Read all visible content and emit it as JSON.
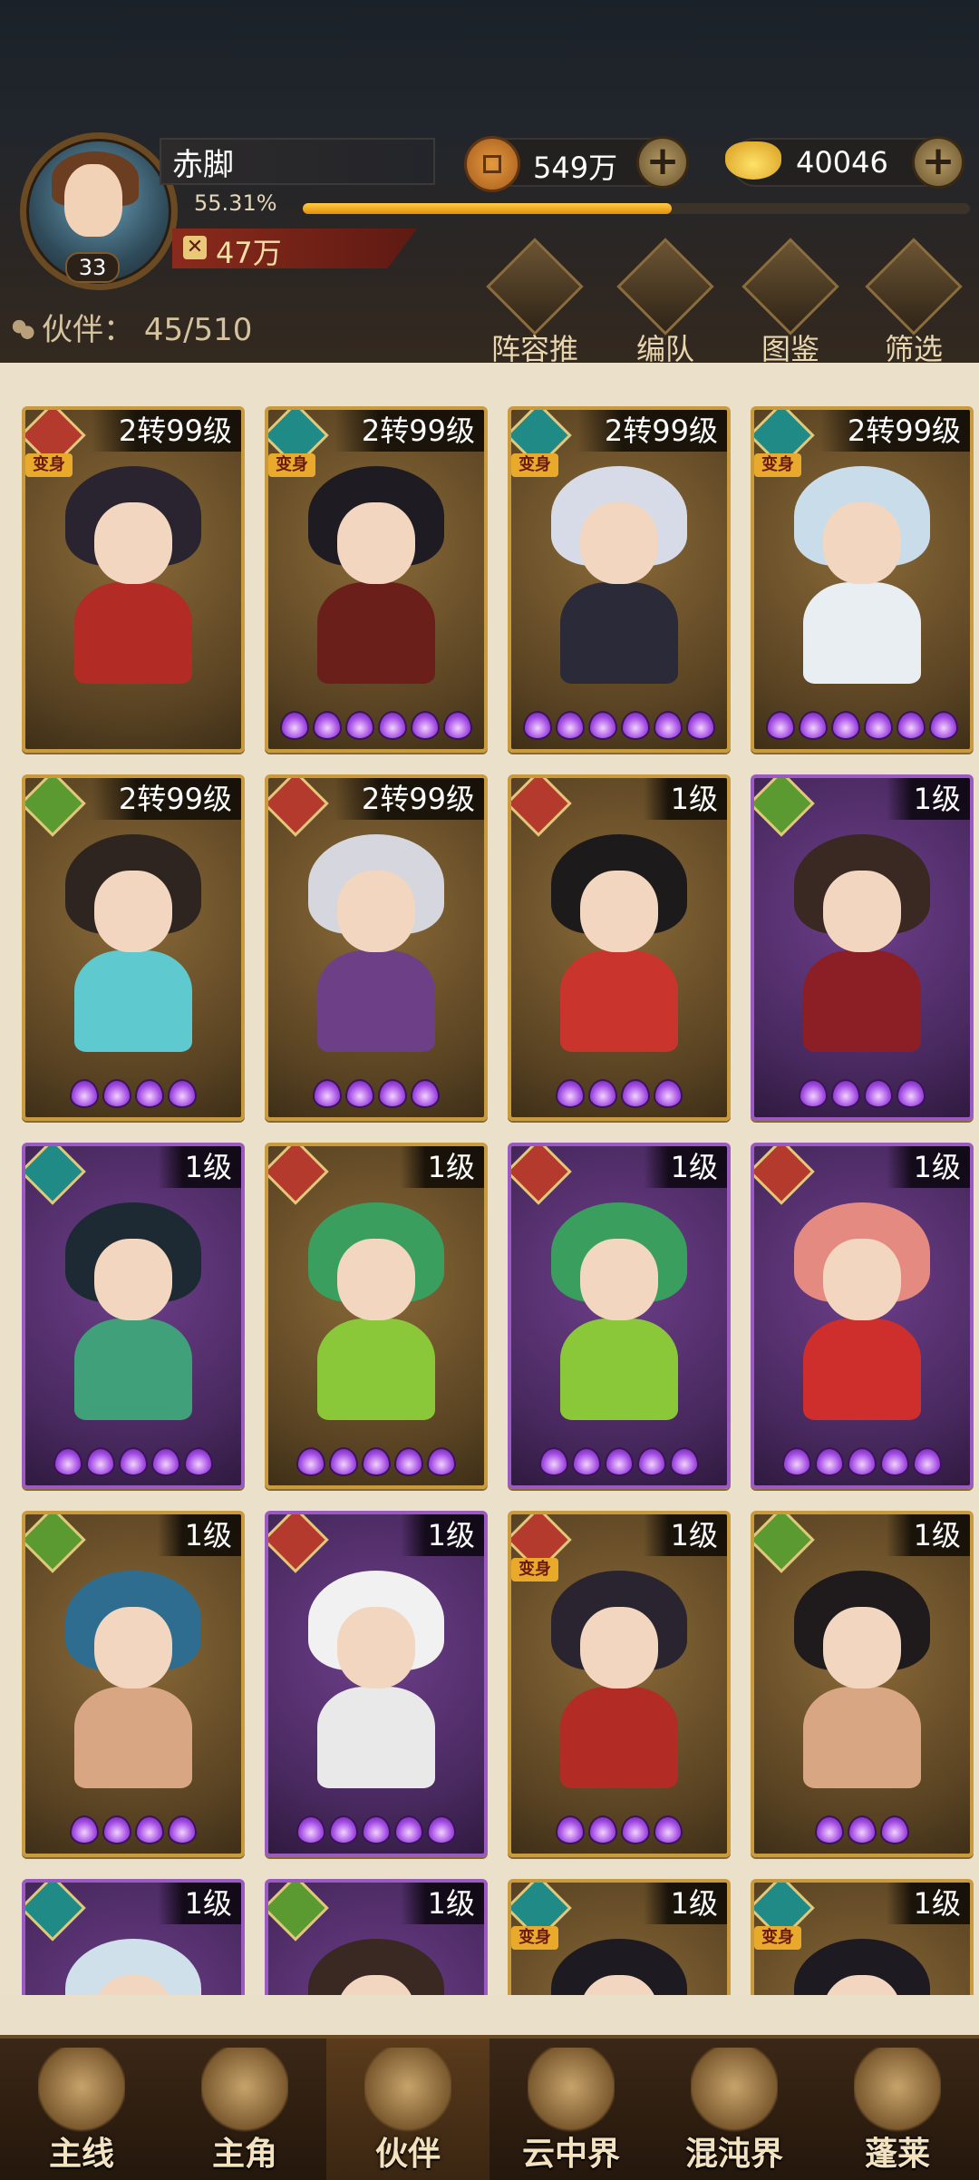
{
  "header": {
    "player_name": "赤脚",
    "player_level": "33",
    "exp_percent_label": "55.31%",
    "exp_fraction": 0.5531,
    "combat_power": "47万",
    "coins": "549万",
    "ingots": "40046",
    "partners_label": "伙伴：",
    "partners_count": "45/510",
    "tools": [
      {
        "label": "阵容推荐",
        "icon": "lineup-recommend-icon"
      },
      {
        "label": "编队",
        "icon": "flag-icon"
      },
      {
        "label": "图鉴",
        "icon": "scroll-icon"
      },
      {
        "label": "筛选",
        "icon": "filter-icon"
      }
    ]
  },
  "cards": [
    {
      "level": "2转99级",
      "element": "fire",
      "transform": true,
      "stars": 0,
      "frame": "gold",
      "hair": "#2a2430",
      "body": "#b22b24"
    },
    {
      "level": "2转99级",
      "element": "water",
      "transform": true,
      "stars": 6,
      "frame": "gold",
      "hair": "#1f1b22",
      "body": "#6a1f1a"
    },
    {
      "level": "2转99级",
      "element": "water",
      "transform": true,
      "stars": 6,
      "frame": "gold",
      "hair": "#d7dbe8",
      "body": "#2b2a38"
    },
    {
      "level": "2转99级",
      "element": "water",
      "transform": true,
      "stars": 6,
      "frame": "gold",
      "hair": "#c9dcea",
      "body": "#e9eef2"
    },
    {
      "level": "2转99级",
      "element": "wind",
      "transform": false,
      "stars": 4,
      "frame": "gold",
      "hair": "#2e2420",
      "body": "#5ecad0"
    },
    {
      "level": "2转99级",
      "element": "fire",
      "transform": false,
      "stars": 4,
      "frame": "gold",
      "hair": "#d5d6de",
      "body": "#6d3f86"
    },
    {
      "level": "1级",
      "element": "fire",
      "transform": false,
      "stars": 4,
      "frame": "gold",
      "hair": "#1d1a1c",
      "body": "#c9352c"
    },
    {
      "level": "1级",
      "element": "wind",
      "transform": false,
      "stars": 4,
      "frame": "purple",
      "hair": "#3a2822",
      "body": "#8c1f26"
    },
    {
      "level": "1级",
      "element": "water",
      "transform": false,
      "stars": 5,
      "frame": "purple",
      "hair": "#1d2a33",
      "body": "#3fa07a"
    },
    {
      "level": "1级",
      "element": "fire",
      "transform": false,
      "stars": 5,
      "frame": "gold",
      "hair": "#3a9f5e",
      "body": "#8ac83a"
    },
    {
      "level": "1级",
      "element": "fire",
      "transform": false,
      "stars": 5,
      "frame": "purple",
      "hair": "#3a9f5e",
      "body": "#8ac83a"
    },
    {
      "level": "1级",
      "element": "fire",
      "transform": false,
      "stars": 5,
      "frame": "purple",
      "hair": "#e58a80",
      "body": "#cf2f2c"
    },
    {
      "level": "1级",
      "element": "wind",
      "transform": false,
      "stars": 4,
      "frame": "gold",
      "hair": "#2e6d8f",
      "body": "#d9a684"
    },
    {
      "level": "1级",
      "element": "fire",
      "transform": false,
      "stars": 5,
      "frame": "purple",
      "hair": "#f1f1f1",
      "body": "#e9e9e9"
    },
    {
      "level": "1级",
      "element": "fire",
      "transform": true,
      "stars": 4,
      "frame": "gold",
      "hair": "#2a2430",
      "body": "#b22b24"
    },
    {
      "level": "1级",
      "element": "wind",
      "transform": false,
      "stars": 3,
      "frame": "gold",
      "hair": "#1f1a1c",
      "body": "#d9a684"
    },
    {
      "level": "1级",
      "element": "water",
      "transform": false,
      "stars": 0,
      "frame": "purple",
      "hair": "#cfe0ea",
      "body": "#2b2a38"
    },
    {
      "level": "1级",
      "element": "wind",
      "transform": false,
      "stars": 0,
      "frame": "purple",
      "hair": "#3a2822",
      "body": "#6a3f2e"
    },
    {
      "level": "1级",
      "element": "water",
      "transform": true,
      "stars": 0,
      "frame": "gold",
      "hair": "#1d1a22",
      "body": "#2b2a38"
    },
    {
      "level": "1级",
      "element": "water",
      "transform": true,
      "stars": 0,
      "frame": "gold",
      "hair": "#1d1a22",
      "body": "#3a2a2a"
    }
  ],
  "transform_badge": "变身",
  "nav": [
    {
      "label": "主线",
      "icon": "crossed-swords-icon",
      "active": false
    },
    {
      "label": "主角",
      "icon": "hero-portrait-icon",
      "active": false
    },
    {
      "label": "伙伴",
      "icon": "crown-icon",
      "active": true
    },
    {
      "label": "云中界",
      "icon": "pavilion-icon",
      "active": false
    },
    {
      "label": "混沌界",
      "icon": "tower-icon",
      "active": false
    },
    {
      "label": "蓬莱",
      "icon": "sage-icon",
      "active": false
    }
  ],
  "colors": {
    "accent_gold": "#c99a3e",
    "rare_purple": "#9b59c2",
    "exp_bar": "#f5b021",
    "fire": "#b43a2d",
    "water": "#1f8a86",
    "wind": "#5b9a31"
  }
}
